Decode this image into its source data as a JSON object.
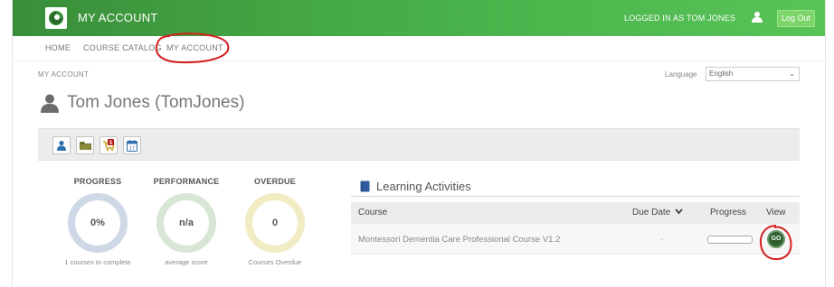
{
  "app": {
    "title": "MY ACCOUNT",
    "logged_in_text": "LOGGED IN AS TOM JONES",
    "logout_label": "Log Out",
    "user_icon": "user-icon",
    "logo_icon": "logo-icon"
  },
  "nav": {
    "items": [
      {
        "label": "HOME"
      },
      {
        "label": "COURSE CATALOG"
      },
      {
        "label": "MY ACCOUNT"
      }
    ]
  },
  "breadcrumb": "MY ACCOUNT",
  "language": {
    "label": "Language",
    "selected": "English"
  },
  "user": {
    "display_name": "Tom Jones (TomJones)"
  },
  "toolbar": {
    "buttons": [
      {
        "icon": "profile-icon"
      },
      {
        "icon": "folder-icon"
      },
      {
        "icon": "cart-icon",
        "badge": "1"
      },
      {
        "icon": "calendar-icon",
        "day": "17"
      }
    ]
  },
  "stats": [
    {
      "title": "PROGRESS",
      "value": "0%",
      "subtitle": "1 courses to complete",
      "ring_color": "#cfd8e6"
    },
    {
      "title": "PERFORMANCE",
      "value": "n/a",
      "subtitle": "average score",
      "ring_color": "#d8e6d5"
    },
    {
      "title": "OVERDUE",
      "value": "0",
      "subtitle": "Courses Overdue",
      "ring_color": "#f2ecc4"
    }
  ],
  "learning_activities": {
    "title": "Learning Activities",
    "columns": {
      "course": "Course",
      "due_date": "Due Date",
      "progress": "Progress",
      "view": "View"
    },
    "rows": [
      {
        "course": "Montessori Dementia Care Professional Course V1.2",
        "due_date": "-",
        "progress": 0,
        "view_label": "GO"
      }
    ]
  },
  "colors": {
    "brand_green": "#46ad46",
    "annotation_red": "#d42020"
  }
}
